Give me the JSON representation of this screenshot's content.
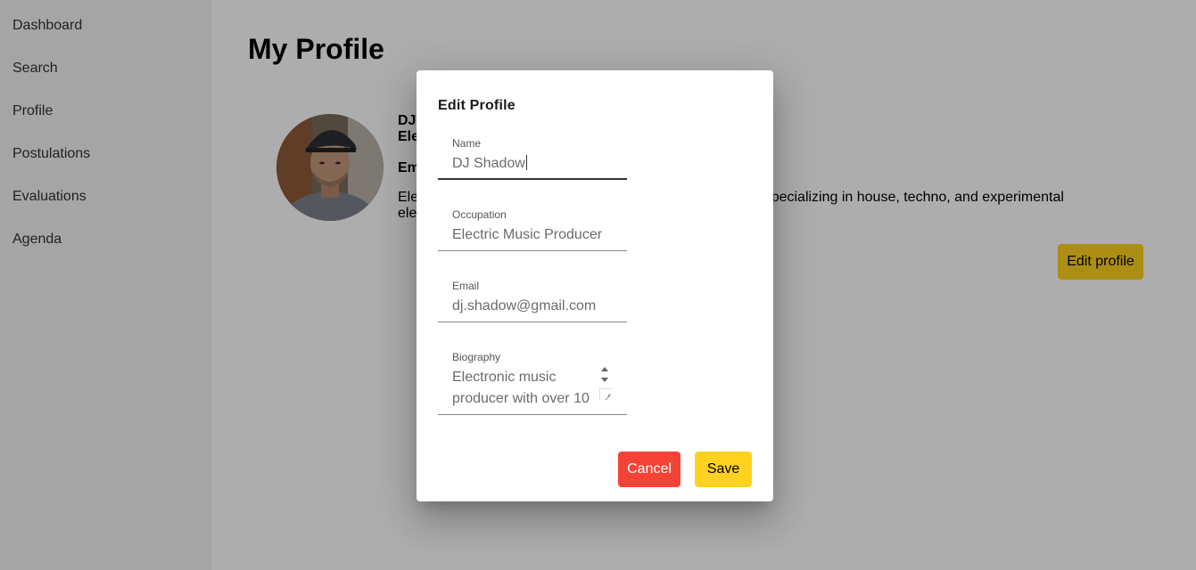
{
  "sidebar": {
    "items": [
      {
        "label": "Dashboard"
      },
      {
        "label": "Search"
      },
      {
        "label": "Profile"
      },
      {
        "label": "Postulations"
      },
      {
        "label": "Evaluations"
      },
      {
        "label": "Agenda"
      }
    ]
  },
  "main": {
    "title": "My Profile",
    "profile": {
      "name": "DJ",
      "occupation": "Ele",
      "email": "Em",
      "bio_line1_start": "Ele",
      "bio_line1_end": ". Specializing in house, techno, and experimental",
      "bio_line2": "ele"
    },
    "edit_button_label": "Edit profile"
  },
  "dialog": {
    "title": "Edit Profile",
    "fields": {
      "name": {
        "label": "Name",
        "value": "DJ Shadow"
      },
      "occupation": {
        "label": "Occupation",
        "value": "Electric Music Producer"
      },
      "email": {
        "label": "Email",
        "value": "dj.shadow@gmail.com"
      },
      "biography": {
        "label": "Biography",
        "value": "Electronic music producer with over 10"
      }
    },
    "cancel_label": "Cancel",
    "save_label": "Save"
  },
  "colors": {
    "primary": "#ffd21f",
    "danger": "#f44336",
    "sidebar_bg": "#f3f3f3"
  },
  "icons": {
    "avatar": "user-photo",
    "spinner": "spin-arrows-icon",
    "resize": "resize-handle-icon"
  }
}
